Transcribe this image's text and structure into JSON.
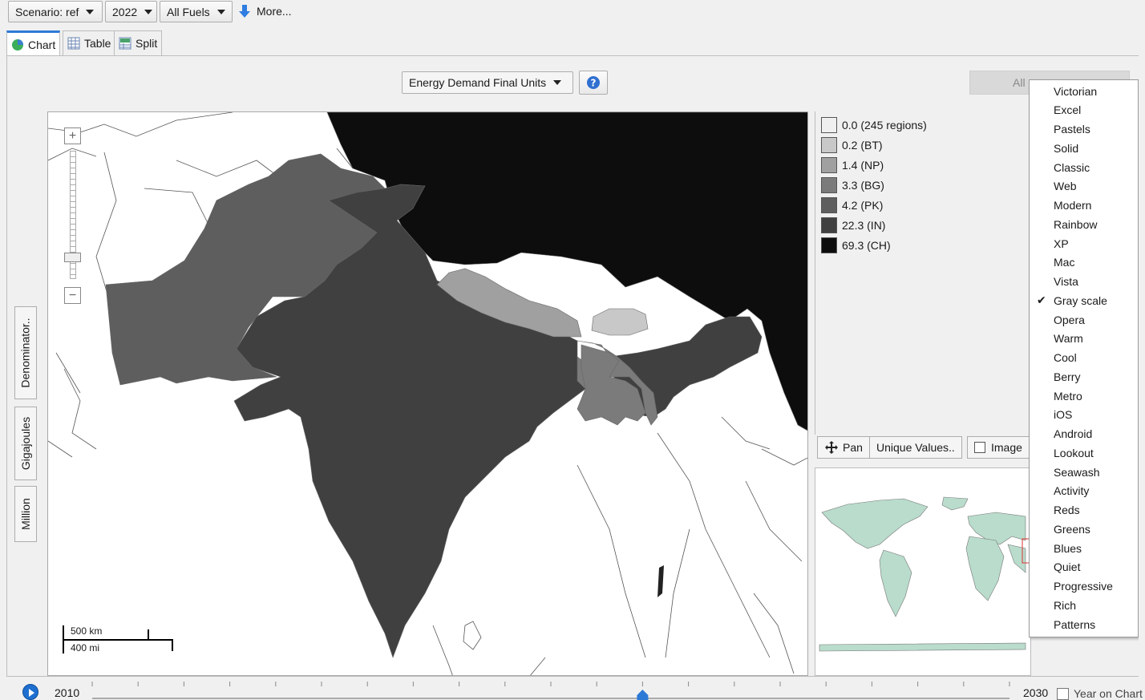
{
  "toolbar": {
    "scenario": "Scenario: ref",
    "year": "2022",
    "fuels": "All Fuels",
    "more": "More..."
  },
  "tabs": [
    {
      "label": "Chart",
      "active": true,
      "icon": "pie-chart-icon"
    },
    {
      "label": "Table",
      "active": false,
      "icon": "table-icon"
    },
    {
      "label": "Split",
      "active": false,
      "icon": "split-view-icon"
    }
  ],
  "header": {
    "measure": "Energy Demand Final Units",
    "help_icon": "help-icon",
    "all_button": "All"
  },
  "side_tabs": [
    "Denominator..",
    "Gigajoules",
    "Million"
  ],
  "map": {
    "scale_km": "500 km",
    "scale_mi": "400 mi",
    "zoom_level": 0.15
  },
  "legend": [
    {
      "label": "0.0 (245 regions)",
      "color": "#efefef"
    },
    {
      "label": "0.2 (BT)",
      "color": "#c8c8c8"
    },
    {
      "label": "1.4 (NP)",
      "color": "#a0a0a0"
    },
    {
      "label": "3.3 (BG)",
      "color": "#7b7b7b"
    },
    {
      "label": "4.2 (PK)",
      "color": "#5e5e5e"
    },
    {
      "label": "22.3 (IN)",
      "color": "#404040"
    },
    {
      "label": "69.3 (CH)",
      "color": "#0d0d0d"
    }
  ],
  "legend_tools": {
    "pan": "Pan",
    "unique": "Unique Values..",
    "image": "Image"
  },
  "palette_menu": {
    "items": [
      "Victorian",
      "Excel",
      "Pastels",
      "Solid",
      "Classic",
      "Web",
      "Modern",
      "Rainbow",
      "XP",
      "Mac",
      "Vista",
      "Gray scale",
      "Opera",
      "Warm",
      "Cool",
      "Berry",
      "Metro",
      "iOS",
      "Android",
      "Lookout",
      "Seawash",
      "Activity",
      "Reds",
      "Greens",
      "Blues",
      "Quiet",
      "Progressive",
      "Rich",
      "Patterns"
    ],
    "checked": "Gray scale"
  },
  "timeline": {
    "start": "2010",
    "end": "2030",
    "year_on_chart": "Year on Chart",
    "position": 0.6
  },
  "colors": {
    "accent": "#2d7ad6",
    "minimap_land": "#b9dccc"
  }
}
